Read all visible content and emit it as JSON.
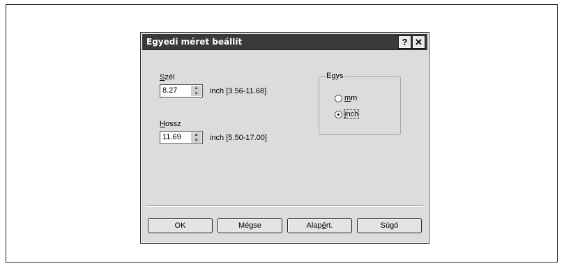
{
  "dialog": {
    "title": "Egyedi méret beállít",
    "help_label": "?",
    "close_label": "✕",
    "width": {
      "label_ul": "S",
      "label_rest": "zél",
      "value": "8.27",
      "range": "inch [3.56-11.68]"
    },
    "height": {
      "label_ul": "H",
      "label_rest": "ossz",
      "value": "11.69",
      "range": "inch [5.50-17.00]"
    },
    "units": {
      "title_pre": "E",
      "title_ul": "g",
      "title_rest": "ys",
      "options": [
        {
          "label_ul": "m",
          "label_rest": "m",
          "selected": false
        },
        {
          "label_ul": "i",
          "label_rest": "nch",
          "selected": true
        }
      ]
    },
    "buttons": {
      "ok": "OK",
      "cancel": "Mégse",
      "default_pre": "Alap",
      "default_ul": "é",
      "default_rest": "rt.",
      "help": "Súgó"
    }
  }
}
